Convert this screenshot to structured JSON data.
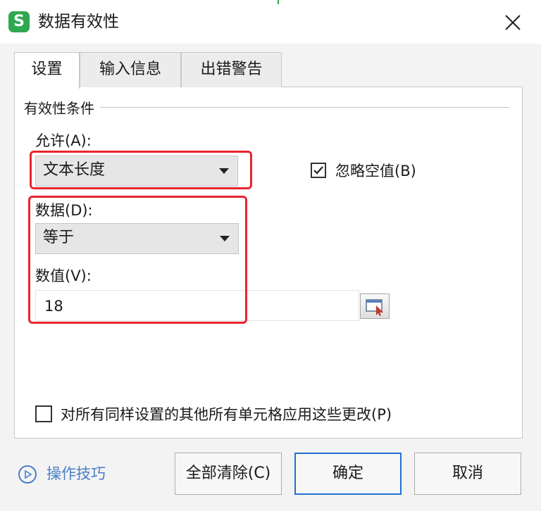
{
  "window": {
    "title": "数据有效性",
    "app_icon_letter": "S"
  },
  "tabs": [
    {
      "label": "设置",
      "selected": true
    },
    {
      "label": "输入信息",
      "selected": false
    },
    {
      "label": "出错警告",
      "selected": false
    }
  ],
  "settings": {
    "section_title": "有效性条件",
    "allow_label": "允许(A):",
    "allow_value": "文本长度",
    "ignore_blank_label": "忽略空值(B)",
    "ignore_blank_checked": true,
    "data_label": "数据(D):",
    "data_value": "等于",
    "value_label": "数值(V):",
    "value_input": "18",
    "apply_all_label": "对所有同样设置的其他所有单元格应用这些更改(P)",
    "apply_all_checked": false
  },
  "footer": {
    "tips_label": "操作技巧",
    "clear_all": "全部清除(C)",
    "ok": "确定",
    "cancel": "取消"
  },
  "colors": {
    "highlight": "#e8252f",
    "accent_blue": "#1f6fd1",
    "link_blue": "#4a7ec7",
    "app_green": "#2fa84f"
  },
  "icons": {
    "app": "wps-spreadsheet-icon",
    "close": "close-icon",
    "checkbox_checked": "checkmark-icon",
    "range_selector": "range-select-icon",
    "tips": "play-circle-icon",
    "dropdown": "caret-down-icon"
  }
}
